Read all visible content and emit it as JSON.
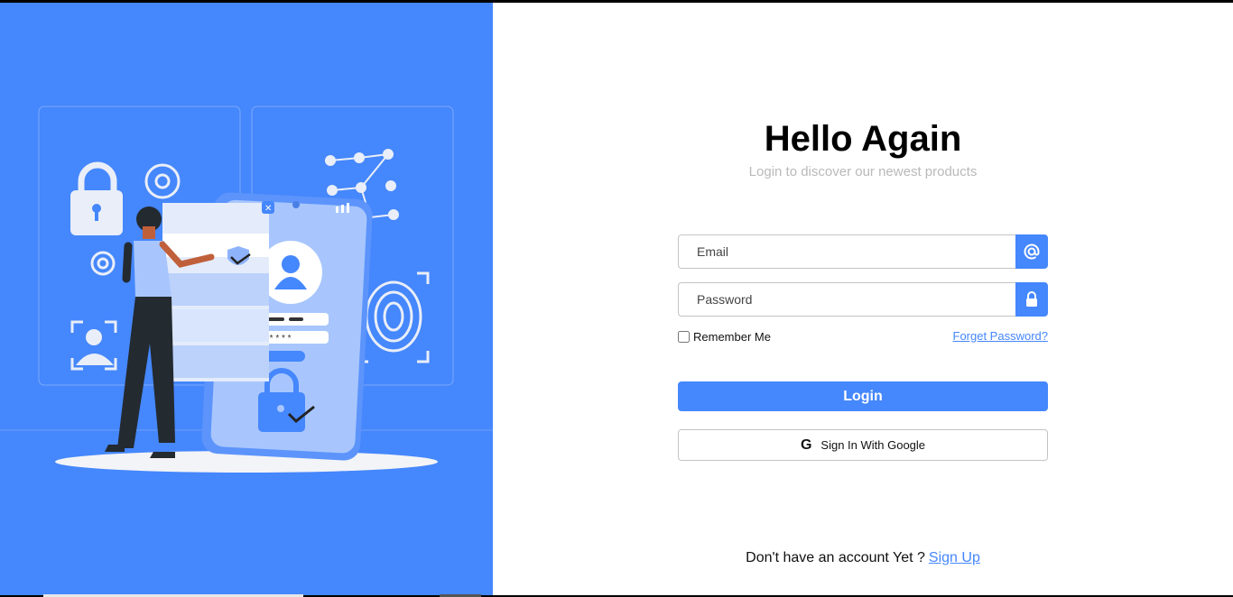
{
  "login": {
    "title": "Hello Again",
    "subtitle": "Login to discover our newest products",
    "email_placeholder": "Email",
    "password_placeholder": "Password",
    "remember_label": "Remember Me",
    "forgot_label": "Forget Password?",
    "login_label": "Login",
    "google_label": "Sign In With Google",
    "google_glyph": "G",
    "signup_prompt": "Don't have an account Yet ?",
    "signup_link": "Sign Up"
  },
  "icons": {
    "email": "at-icon",
    "password": "lock-icon",
    "google": "google-icon"
  },
  "colors": {
    "accent": "#4587fc",
    "panel": "#4587fc",
    "subtitle": "#b9b9b9"
  }
}
